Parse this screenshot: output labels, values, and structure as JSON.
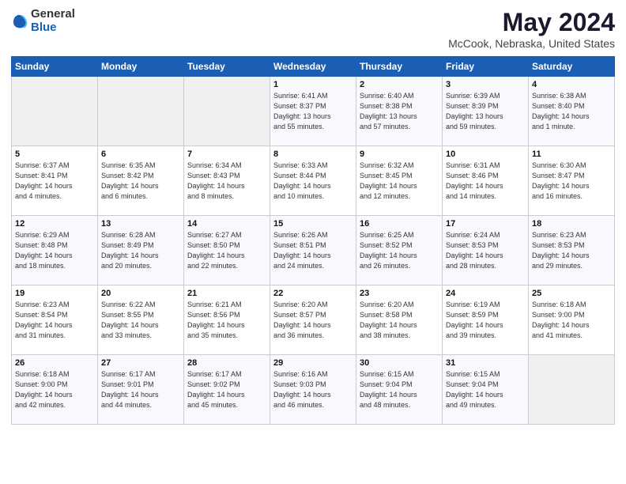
{
  "logo": {
    "general": "General",
    "blue": "Blue"
  },
  "header": {
    "title": "May 2024",
    "subtitle": "McCook, Nebraska, United States"
  },
  "weekdays": [
    "Sunday",
    "Monday",
    "Tuesday",
    "Wednesday",
    "Thursday",
    "Friday",
    "Saturday"
  ],
  "weeks": [
    [
      {
        "day": "",
        "info": ""
      },
      {
        "day": "",
        "info": ""
      },
      {
        "day": "",
        "info": ""
      },
      {
        "day": "1",
        "info": "Sunrise: 6:41 AM\nSunset: 8:37 PM\nDaylight: 13 hours\nand 55 minutes."
      },
      {
        "day": "2",
        "info": "Sunrise: 6:40 AM\nSunset: 8:38 PM\nDaylight: 13 hours\nand 57 minutes."
      },
      {
        "day": "3",
        "info": "Sunrise: 6:39 AM\nSunset: 8:39 PM\nDaylight: 13 hours\nand 59 minutes."
      },
      {
        "day": "4",
        "info": "Sunrise: 6:38 AM\nSunset: 8:40 PM\nDaylight: 14 hours\nand 1 minute."
      }
    ],
    [
      {
        "day": "5",
        "info": "Sunrise: 6:37 AM\nSunset: 8:41 PM\nDaylight: 14 hours\nand 4 minutes."
      },
      {
        "day": "6",
        "info": "Sunrise: 6:35 AM\nSunset: 8:42 PM\nDaylight: 14 hours\nand 6 minutes."
      },
      {
        "day": "7",
        "info": "Sunrise: 6:34 AM\nSunset: 8:43 PM\nDaylight: 14 hours\nand 8 minutes."
      },
      {
        "day": "8",
        "info": "Sunrise: 6:33 AM\nSunset: 8:44 PM\nDaylight: 14 hours\nand 10 minutes."
      },
      {
        "day": "9",
        "info": "Sunrise: 6:32 AM\nSunset: 8:45 PM\nDaylight: 14 hours\nand 12 minutes."
      },
      {
        "day": "10",
        "info": "Sunrise: 6:31 AM\nSunset: 8:46 PM\nDaylight: 14 hours\nand 14 minutes."
      },
      {
        "day": "11",
        "info": "Sunrise: 6:30 AM\nSunset: 8:47 PM\nDaylight: 14 hours\nand 16 minutes."
      }
    ],
    [
      {
        "day": "12",
        "info": "Sunrise: 6:29 AM\nSunset: 8:48 PM\nDaylight: 14 hours\nand 18 minutes."
      },
      {
        "day": "13",
        "info": "Sunrise: 6:28 AM\nSunset: 8:49 PM\nDaylight: 14 hours\nand 20 minutes."
      },
      {
        "day": "14",
        "info": "Sunrise: 6:27 AM\nSunset: 8:50 PM\nDaylight: 14 hours\nand 22 minutes."
      },
      {
        "day": "15",
        "info": "Sunrise: 6:26 AM\nSunset: 8:51 PM\nDaylight: 14 hours\nand 24 minutes."
      },
      {
        "day": "16",
        "info": "Sunrise: 6:25 AM\nSunset: 8:52 PM\nDaylight: 14 hours\nand 26 minutes."
      },
      {
        "day": "17",
        "info": "Sunrise: 6:24 AM\nSunset: 8:53 PM\nDaylight: 14 hours\nand 28 minutes."
      },
      {
        "day": "18",
        "info": "Sunrise: 6:23 AM\nSunset: 8:53 PM\nDaylight: 14 hours\nand 29 minutes."
      }
    ],
    [
      {
        "day": "19",
        "info": "Sunrise: 6:23 AM\nSunset: 8:54 PM\nDaylight: 14 hours\nand 31 minutes."
      },
      {
        "day": "20",
        "info": "Sunrise: 6:22 AM\nSunset: 8:55 PM\nDaylight: 14 hours\nand 33 minutes."
      },
      {
        "day": "21",
        "info": "Sunrise: 6:21 AM\nSunset: 8:56 PM\nDaylight: 14 hours\nand 35 minutes."
      },
      {
        "day": "22",
        "info": "Sunrise: 6:20 AM\nSunset: 8:57 PM\nDaylight: 14 hours\nand 36 minutes."
      },
      {
        "day": "23",
        "info": "Sunrise: 6:20 AM\nSunset: 8:58 PM\nDaylight: 14 hours\nand 38 minutes."
      },
      {
        "day": "24",
        "info": "Sunrise: 6:19 AM\nSunset: 8:59 PM\nDaylight: 14 hours\nand 39 minutes."
      },
      {
        "day": "25",
        "info": "Sunrise: 6:18 AM\nSunset: 9:00 PM\nDaylight: 14 hours\nand 41 minutes."
      }
    ],
    [
      {
        "day": "26",
        "info": "Sunrise: 6:18 AM\nSunset: 9:00 PM\nDaylight: 14 hours\nand 42 minutes."
      },
      {
        "day": "27",
        "info": "Sunrise: 6:17 AM\nSunset: 9:01 PM\nDaylight: 14 hours\nand 44 minutes."
      },
      {
        "day": "28",
        "info": "Sunrise: 6:17 AM\nSunset: 9:02 PM\nDaylight: 14 hours\nand 45 minutes."
      },
      {
        "day": "29",
        "info": "Sunrise: 6:16 AM\nSunset: 9:03 PM\nDaylight: 14 hours\nand 46 minutes."
      },
      {
        "day": "30",
        "info": "Sunrise: 6:15 AM\nSunset: 9:04 PM\nDaylight: 14 hours\nand 48 minutes."
      },
      {
        "day": "31",
        "info": "Sunrise: 6:15 AM\nSunset: 9:04 PM\nDaylight: 14 hours\nand 49 minutes."
      },
      {
        "day": "",
        "info": ""
      }
    ]
  ]
}
